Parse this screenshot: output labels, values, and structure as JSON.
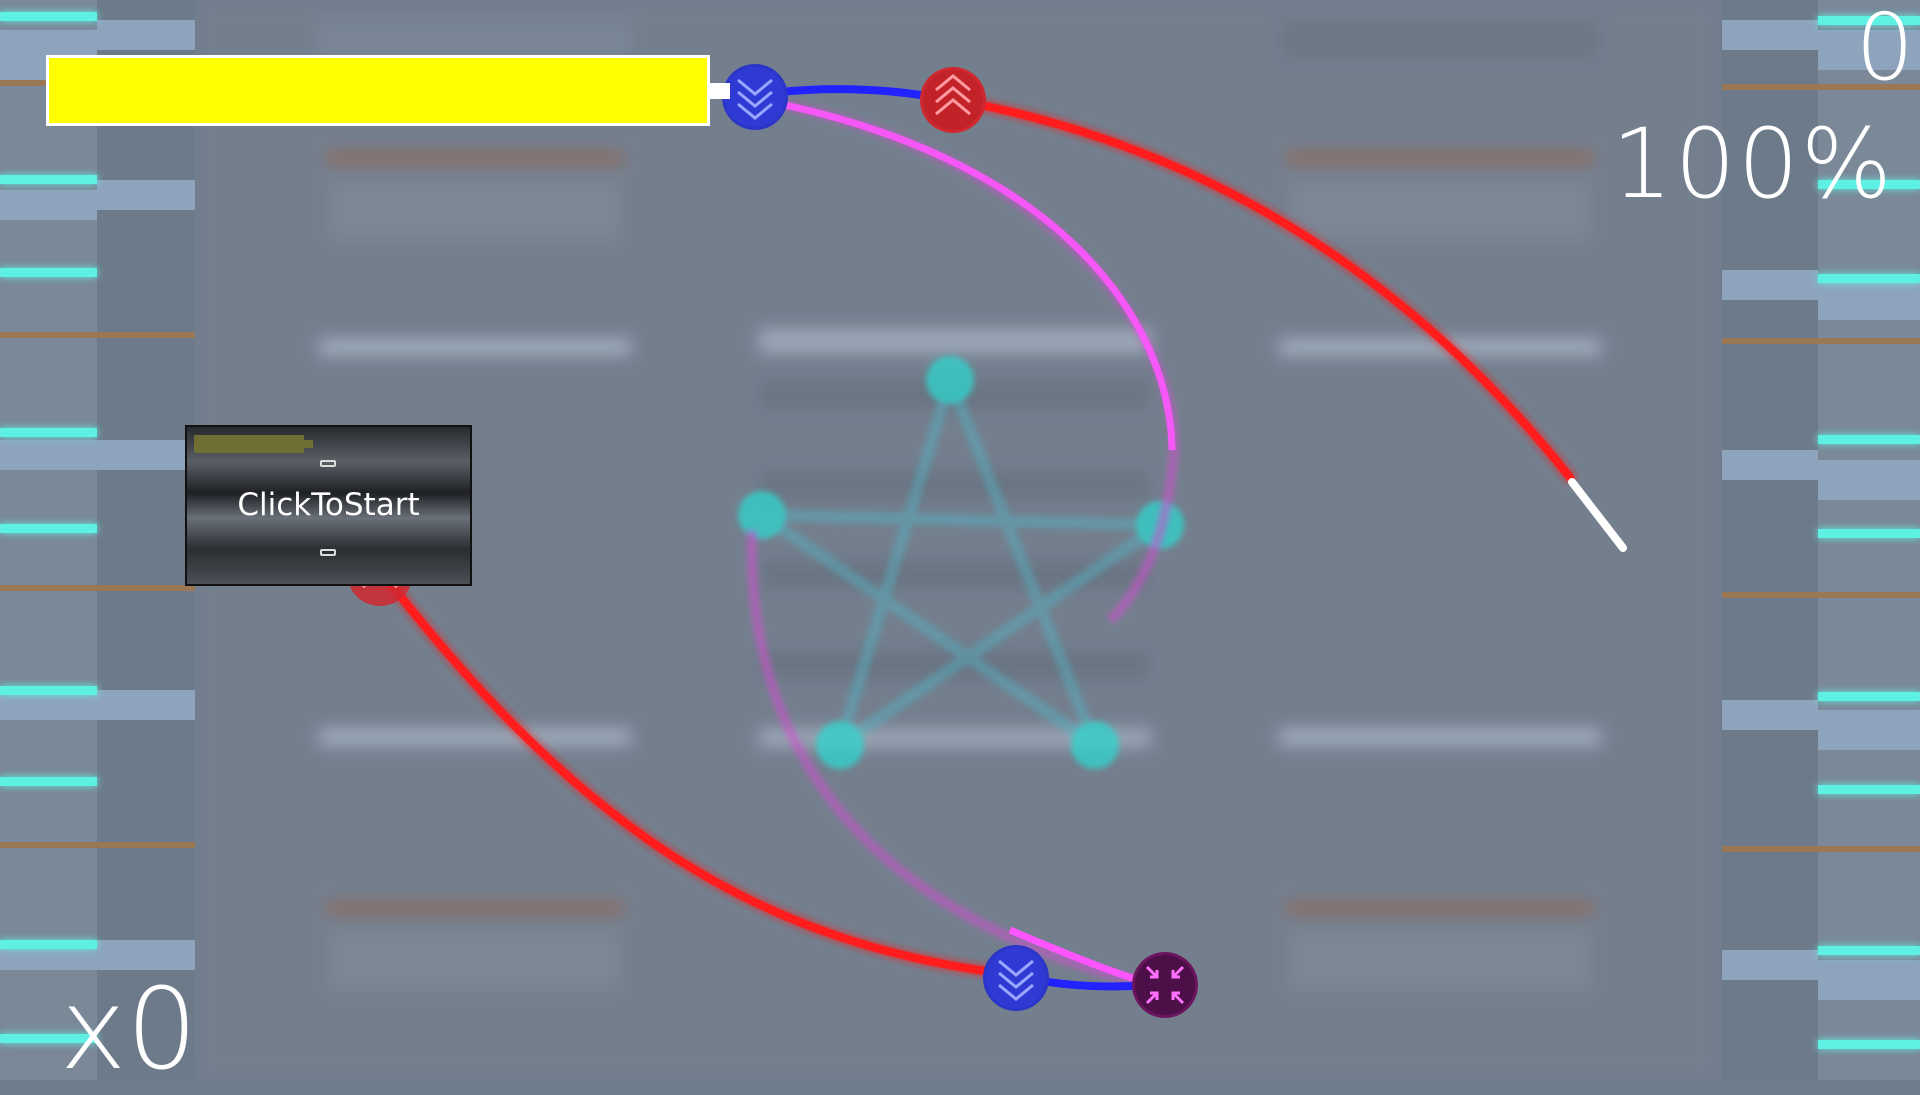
{
  "hud": {
    "score": "0",
    "accuracy": "100%",
    "combo": "x0",
    "health_level": 1.0
  },
  "start_panel": {
    "label": "ClickToStart"
  },
  "colors": {
    "health_bar": "#ffff00",
    "slider_path": "#ff1a1a",
    "hold_path": "#1a1aff",
    "spin_path": "#e040e0",
    "pentagram": "#2fd6cf",
    "lane_glow": "#5ff0e4"
  },
  "notes": [
    {
      "kind": "down-arrow",
      "color": "#2b35c8",
      "icon": "chevron-down-icon"
    },
    {
      "kind": "up-arrow",
      "color": "#d02830",
      "icon": "chevron-up-icon"
    },
    {
      "kind": "up-arrow",
      "color": "#d02830",
      "icon": "chevron-up-icon"
    },
    {
      "kind": "down-arrow",
      "color": "#2b35c8",
      "icon": "chevron-down-icon"
    },
    {
      "kind": "spin",
      "color": "#7a1a7a",
      "icon": "collapse-arrows-icon"
    }
  ]
}
